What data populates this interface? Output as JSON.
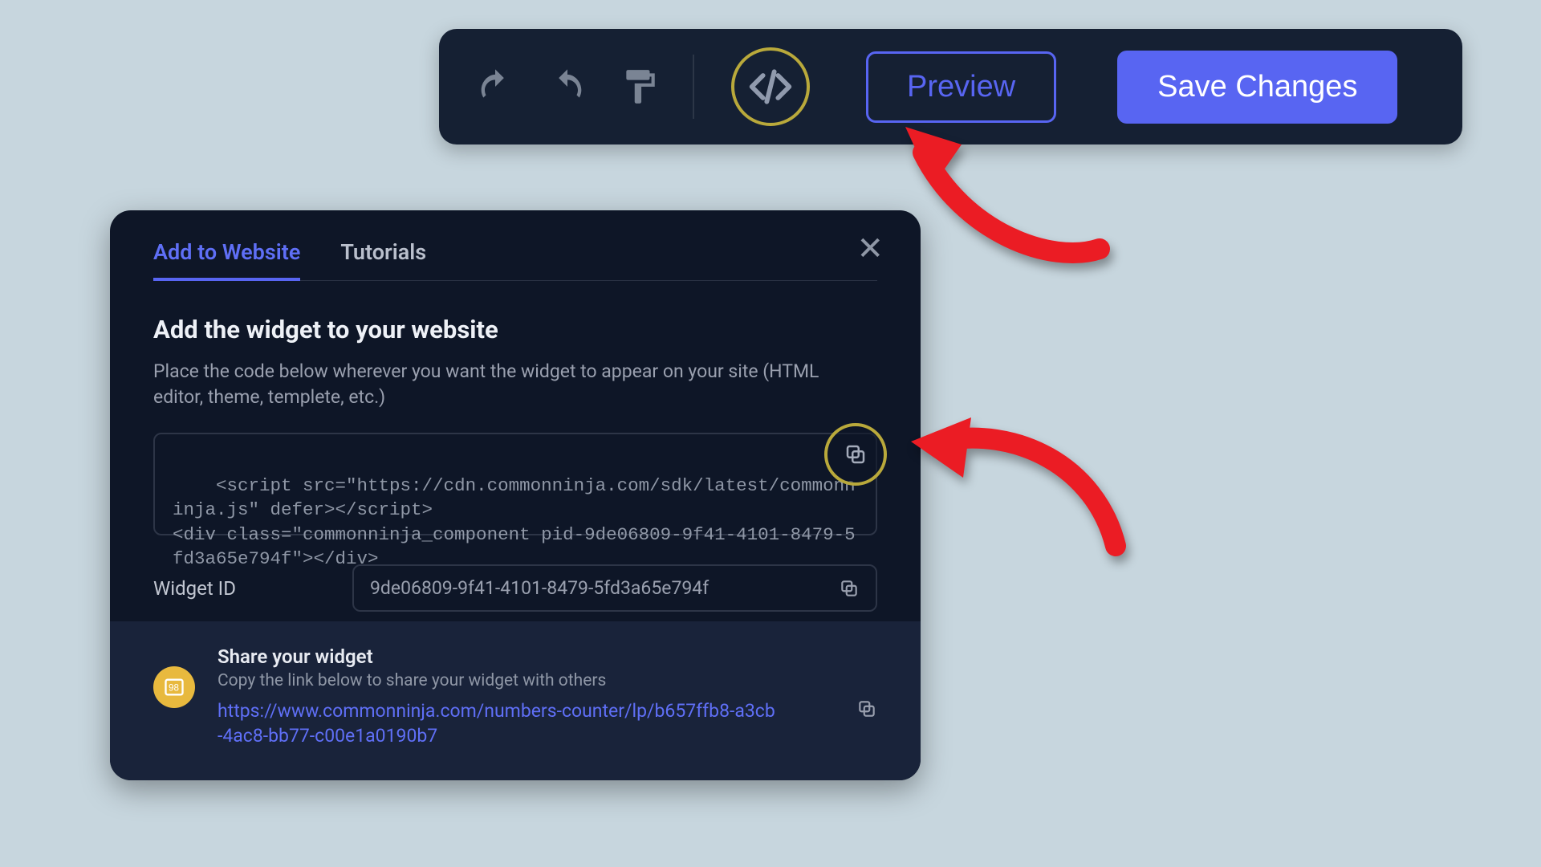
{
  "toolbar": {
    "preview_label": "Preview",
    "save_label": "Save Changes"
  },
  "modal": {
    "tabs": {
      "add_to_website": "Add to Website",
      "tutorials": "Tutorials"
    },
    "section_title": "Add the widget to your website",
    "section_desc": "Place the code below wherever you want the widget to appear on your site (HTML editor, theme, templete, etc.)",
    "code_snippet": "<script src=\"https://cdn.commonninja.com/sdk/latest/commonninja.js\" defer></script>\n<div class=\"commonninja_component pid-9de06809-9f41-4101-8479-5fd3a65e794f\"></div>",
    "widget_id_label": "Widget ID",
    "widget_id_value": "9de06809-9f41-4101-8479-5fd3a65e794f",
    "share_title": "Share your widget",
    "share_desc": "Copy the link below to share your widget with others",
    "share_link": "https://www.commonninja.com/numbers-counter/lp/b657ffb8-a3cb-4ac8-bb77-c00e1a0190b7"
  },
  "colors": {
    "accent": "#5865f2",
    "highlight": "#b9a93b",
    "arrow": "#eb1c24"
  }
}
